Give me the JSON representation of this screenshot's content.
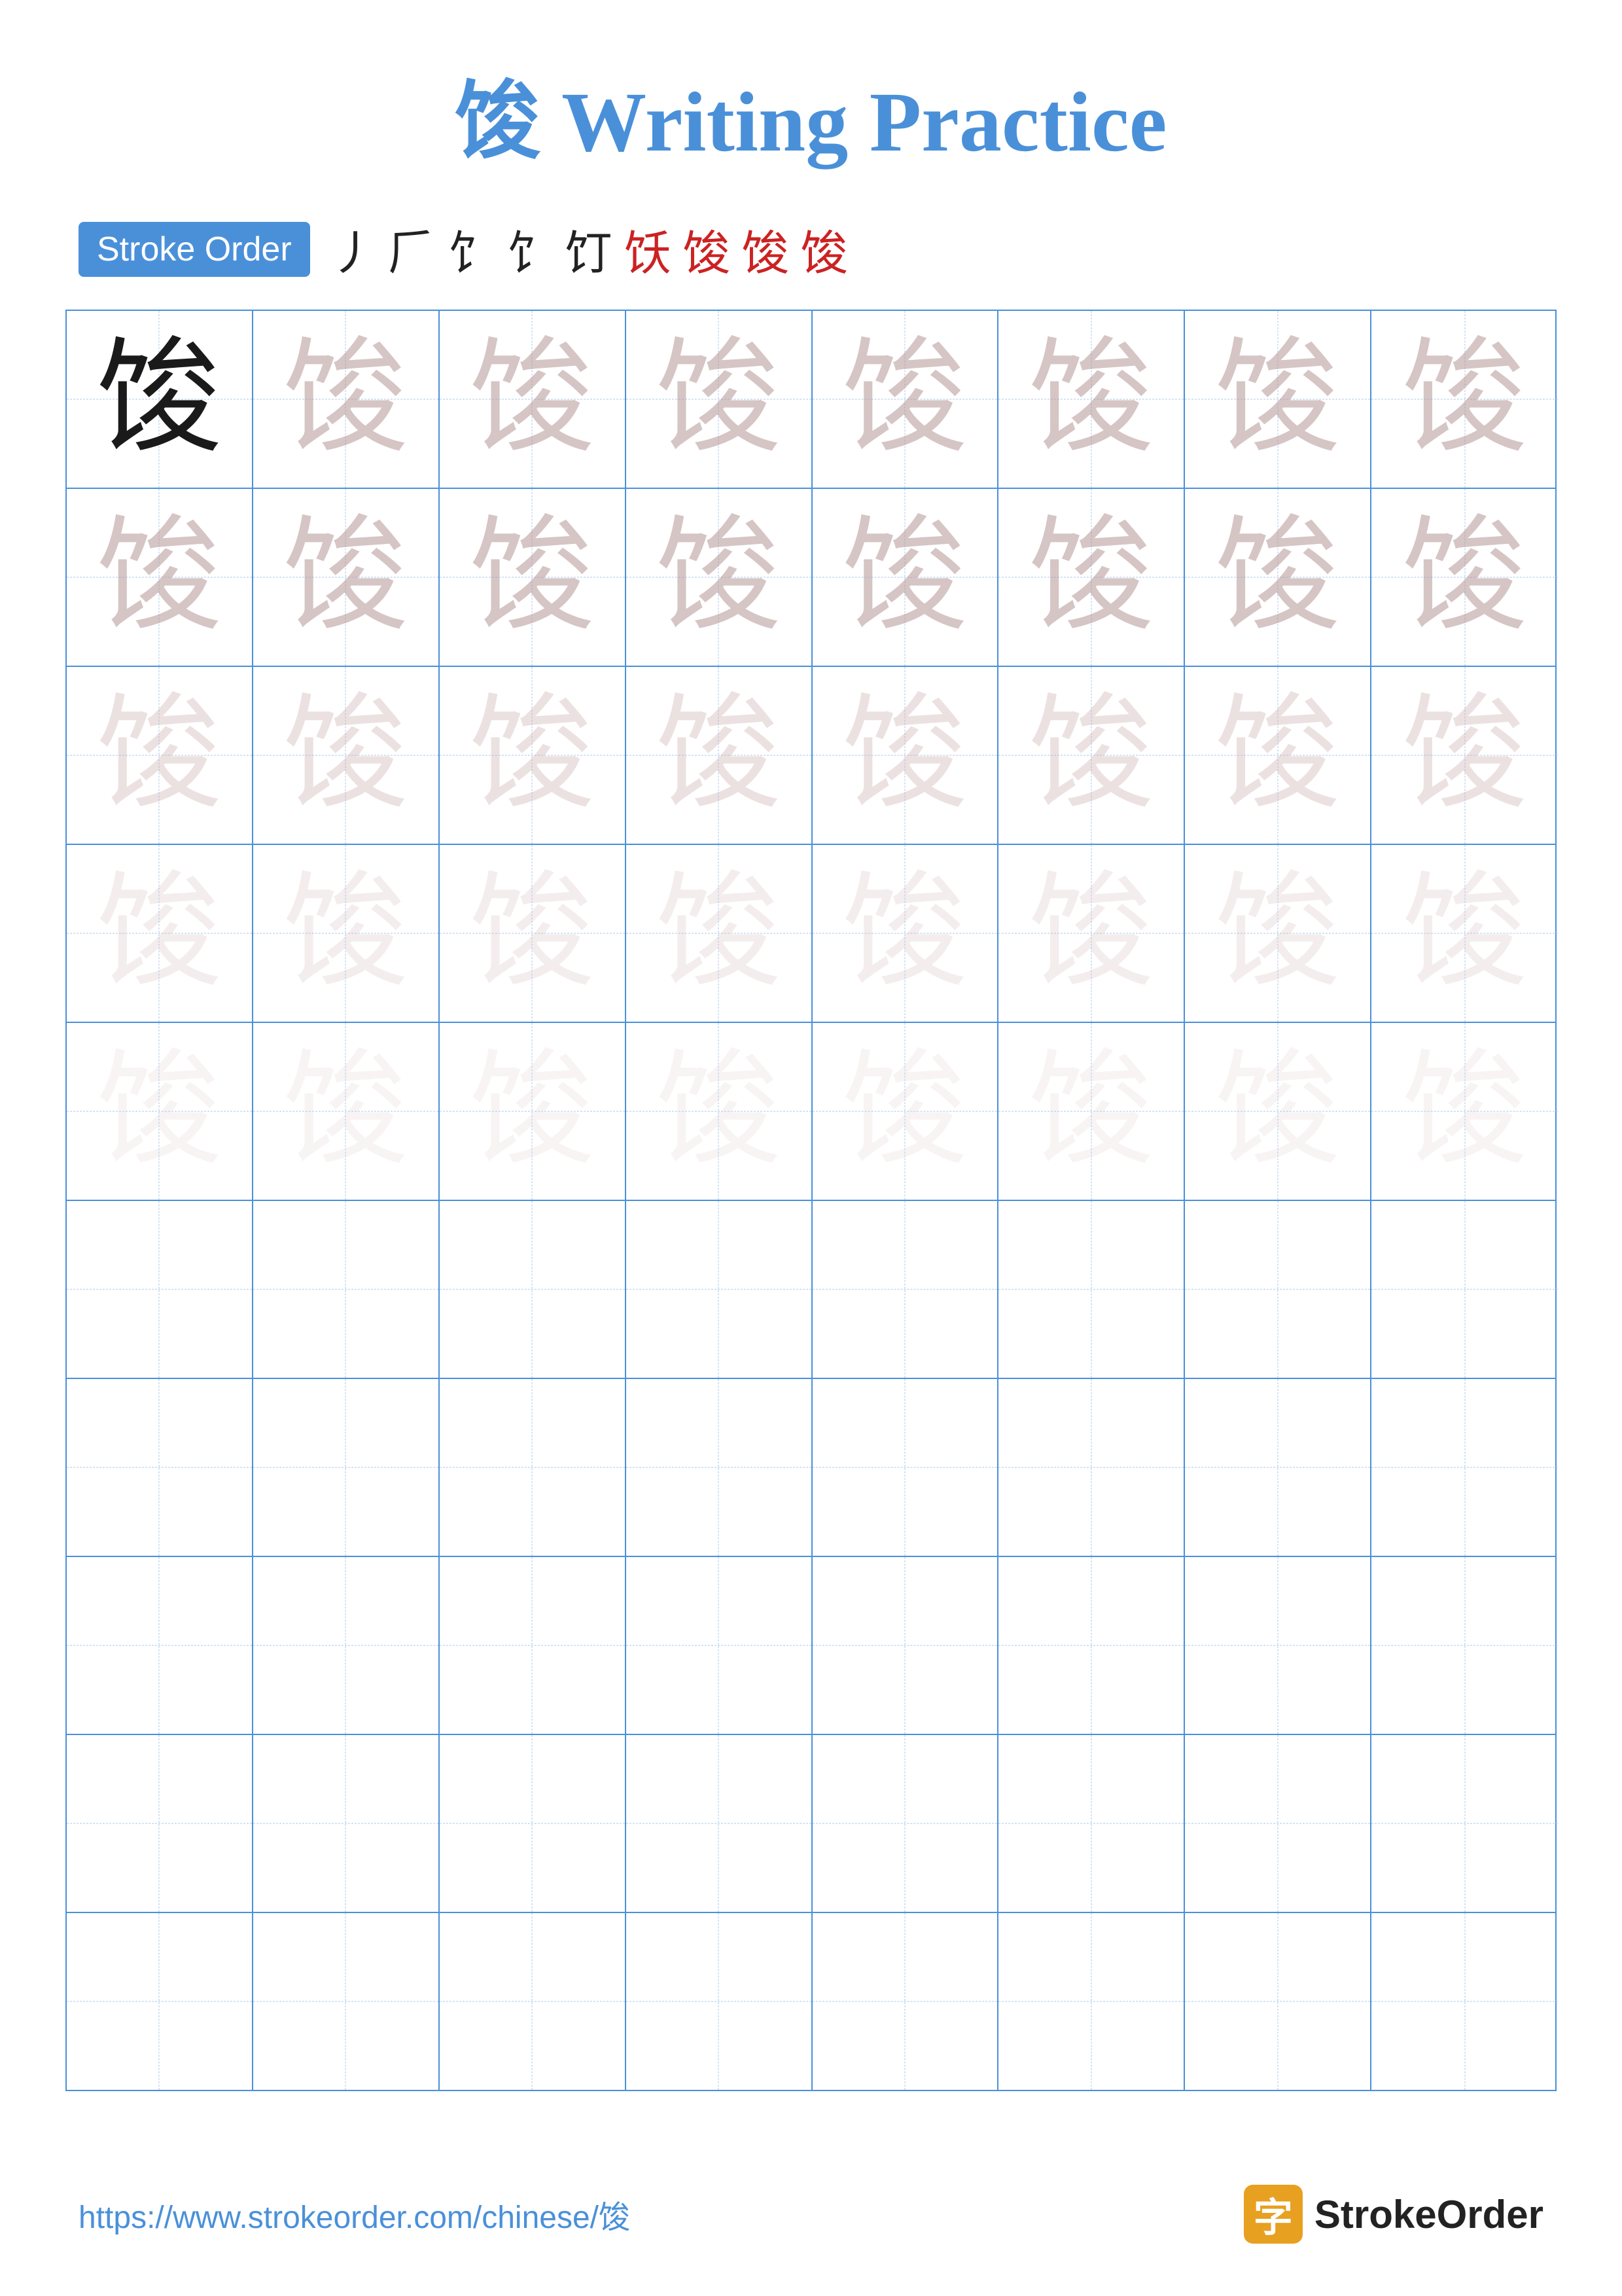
{
  "page": {
    "title_char": "馂",
    "title_text": " Writing Practice"
  },
  "stroke_order": {
    "badge_label": "Stroke Order",
    "strokes": [
      "丿",
      "ㄅ",
      "饣",
      "饣",
      "饬",
      "饫",
      "馂",
      "馂",
      "馂"
    ]
  },
  "grid": {
    "char": "馂",
    "rows": 10,
    "cols": 8,
    "practice_rows": 5,
    "empty_rows": 5
  },
  "footer": {
    "url": "https://www.strokeorder.com/chinese/馂",
    "brand": "StrokeOrder"
  }
}
